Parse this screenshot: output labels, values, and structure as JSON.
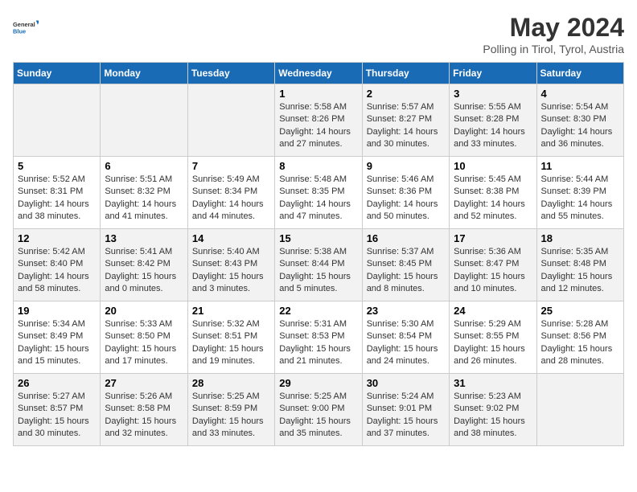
{
  "logo": {
    "text_general": "General",
    "text_blue": "Blue"
  },
  "header": {
    "month_title": "May 2024",
    "subtitle": "Polling in Tirol, Tyrol, Austria"
  },
  "days_of_week": [
    "Sunday",
    "Monday",
    "Tuesday",
    "Wednesday",
    "Thursday",
    "Friday",
    "Saturday"
  ],
  "weeks": [
    [
      {
        "day": "",
        "info": ""
      },
      {
        "day": "",
        "info": ""
      },
      {
        "day": "",
        "info": ""
      },
      {
        "day": "1",
        "info": "Sunrise: 5:58 AM\nSunset: 8:26 PM\nDaylight: 14 hours\nand 27 minutes."
      },
      {
        "day": "2",
        "info": "Sunrise: 5:57 AM\nSunset: 8:27 PM\nDaylight: 14 hours\nand 30 minutes."
      },
      {
        "day": "3",
        "info": "Sunrise: 5:55 AM\nSunset: 8:28 PM\nDaylight: 14 hours\nand 33 minutes."
      },
      {
        "day": "4",
        "info": "Sunrise: 5:54 AM\nSunset: 8:30 PM\nDaylight: 14 hours\nand 36 minutes."
      }
    ],
    [
      {
        "day": "5",
        "info": "Sunrise: 5:52 AM\nSunset: 8:31 PM\nDaylight: 14 hours\nand 38 minutes."
      },
      {
        "day": "6",
        "info": "Sunrise: 5:51 AM\nSunset: 8:32 PM\nDaylight: 14 hours\nand 41 minutes."
      },
      {
        "day": "7",
        "info": "Sunrise: 5:49 AM\nSunset: 8:34 PM\nDaylight: 14 hours\nand 44 minutes."
      },
      {
        "day": "8",
        "info": "Sunrise: 5:48 AM\nSunset: 8:35 PM\nDaylight: 14 hours\nand 47 minutes."
      },
      {
        "day": "9",
        "info": "Sunrise: 5:46 AM\nSunset: 8:36 PM\nDaylight: 14 hours\nand 50 minutes."
      },
      {
        "day": "10",
        "info": "Sunrise: 5:45 AM\nSunset: 8:38 PM\nDaylight: 14 hours\nand 52 minutes."
      },
      {
        "day": "11",
        "info": "Sunrise: 5:44 AM\nSunset: 8:39 PM\nDaylight: 14 hours\nand 55 minutes."
      }
    ],
    [
      {
        "day": "12",
        "info": "Sunrise: 5:42 AM\nSunset: 8:40 PM\nDaylight: 14 hours\nand 58 minutes."
      },
      {
        "day": "13",
        "info": "Sunrise: 5:41 AM\nSunset: 8:42 PM\nDaylight: 15 hours\nand 0 minutes."
      },
      {
        "day": "14",
        "info": "Sunrise: 5:40 AM\nSunset: 8:43 PM\nDaylight: 15 hours\nand 3 minutes."
      },
      {
        "day": "15",
        "info": "Sunrise: 5:38 AM\nSunset: 8:44 PM\nDaylight: 15 hours\nand 5 minutes."
      },
      {
        "day": "16",
        "info": "Sunrise: 5:37 AM\nSunset: 8:45 PM\nDaylight: 15 hours\nand 8 minutes."
      },
      {
        "day": "17",
        "info": "Sunrise: 5:36 AM\nSunset: 8:47 PM\nDaylight: 15 hours\nand 10 minutes."
      },
      {
        "day": "18",
        "info": "Sunrise: 5:35 AM\nSunset: 8:48 PM\nDaylight: 15 hours\nand 12 minutes."
      }
    ],
    [
      {
        "day": "19",
        "info": "Sunrise: 5:34 AM\nSunset: 8:49 PM\nDaylight: 15 hours\nand 15 minutes."
      },
      {
        "day": "20",
        "info": "Sunrise: 5:33 AM\nSunset: 8:50 PM\nDaylight: 15 hours\nand 17 minutes."
      },
      {
        "day": "21",
        "info": "Sunrise: 5:32 AM\nSunset: 8:51 PM\nDaylight: 15 hours\nand 19 minutes."
      },
      {
        "day": "22",
        "info": "Sunrise: 5:31 AM\nSunset: 8:53 PM\nDaylight: 15 hours\nand 21 minutes."
      },
      {
        "day": "23",
        "info": "Sunrise: 5:30 AM\nSunset: 8:54 PM\nDaylight: 15 hours\nand 24 minutes."
      },
      {
        "day": "24",
        "info": "Sunrise: 5:29 AM\nSunset: 8:55 PM\nDaylight: 15 hours\nand 26 minutes."
      },
      {
        "day": "25",
        "info": "Sunrise: 5:28 AM\nSunset: 8:56 PM\nDaylight: 15 hours\nand 28 minutes."
      }
    ],
    [
      {
        "day": "26",
        "info": "Sunrise: 5:27 AM\nSunset: 8:57 PM\nDaylight: 15 hours\nand 30 minutes."
      },
      {
        "day": "27",
        "info": "Sunrise: 5:26 AM\nSunset: 8:58 PM\nDaylight: 15 hours\nand 32 minutes."
      },
      {
        "day": "28",
        "info": "Sunrise: 5:25 AM\nSunset: 8:59 PM\nDaylight: 15 hours\nand 33 minutes."
      },
      {
        "day": "29",
        "info": "Sunrise: 5:25 AM\nSunset: 9:00 PM\nDaylight: 15 hours\nand 35 minutes."
      },
      {
        "day": "30",
        "info": "Sunrise: 5:24 AM\nSunset: 9:01 PM\nDaylight: 15 hours\nand 37 minutes."
      },
      {
        "day": "31",
        "info": "Sunrise: 5:23 AM\nSunset: 9:02 PM\nDaylight: 15 hours\nand 38 minutes."
      },
      {
        "day": "",
        "info": ""
      }
    ]
  ]
}
